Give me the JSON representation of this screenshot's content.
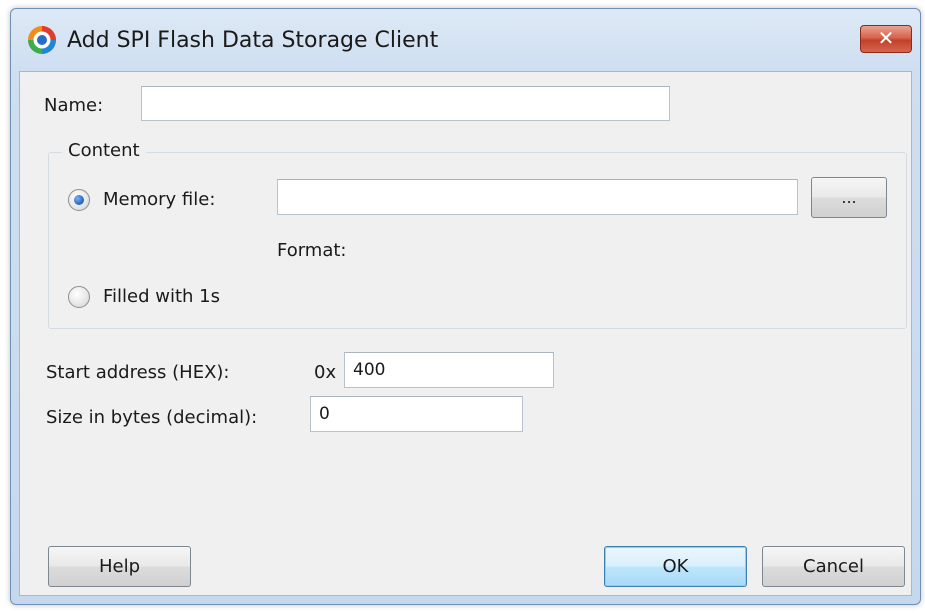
{
  "window": {
    "title": "Add SPI Flash Data Storage Client"
  },
  "form": {
    "name_label": "Name:",
    "name_value": "",
    "content_group_label": "Content",
    "memory_file_label": "Memory file:",
    "memory_file_value": "",
    "browse_label": "...",
    "format_label": "Format:",
    "filled_label": "Filled with 1s",
    "selected_content_option": "Memory file",
    "start_address_label": "Start address (HEX):",
    "start_address_prefix": "0x",
    "start_address_value": "400",
    "size_label": "Size in bytes (decimal):",
    "size_value": "0"
  },
  "buttons": {
    "help": "Help",
    "ok": "OK",
    "cancel": "Cancel",
    "close_glyph": "✕"
  },
  "colors": {
    "title_bar": "#cfdff1",
    "close_button": "#c1412a",
    "dialog_body": "#f0f0f0",
    "radio_selected": "#2a6bc3",
    "default_button_border": "#3c7fb1"
  }
}
